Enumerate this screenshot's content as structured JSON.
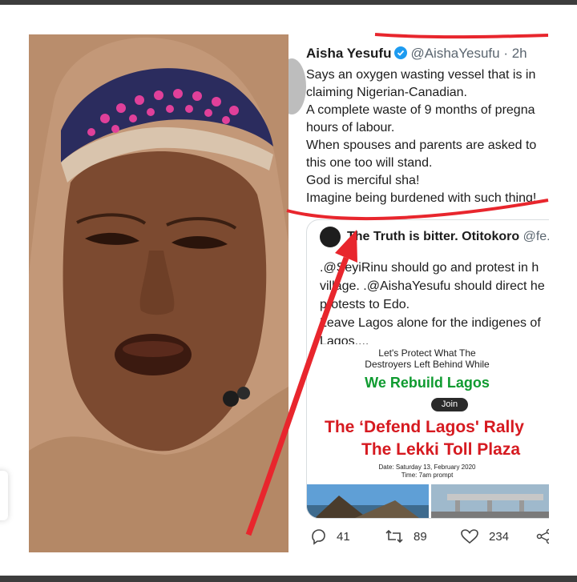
{
  "tweet": {
    "display_name": "Aisha Yesufu",
    "handle_time": "@AishaYesufu · 2h",
    "lines": [
      "Says an oxygen wasting vessel that is in",
      "claiming Nigerian-Canadian.",
      "A complete waste of 9 months of pregna",
      "hours of labour.",
      "When spouses and parents are asked to",
      "this one too will stand.",
      "God is merciful sha!",
      "Imagine being burdened with such thing!"
    ]
  },
  "quoted": {
    "display_name": "The Truth is bitter. Otitokoro",
    "handle": "@fe..",
    "lines": [
      ".@SeyiRinu should go and protest in h",
      "village. .@AishaYesufu should direct he",
      "protests to Edo.",
      "Leave Lagos alone for the indigenes of",
      "Lagos...."
    ],
    "flyer": {
      "line1": "Let's Protect What The",
      "line2": "Destroyers Left Behind While",
      "rebuild": "We Rebuild Lagos",
      "join": "Join",
      "title1": "The ‘Defend Lagos' Rally",
      "title2": "The Lekki Toll Plaza",
      "date": "Date: Saturday 13, February 2020",
      "time": "Time: 7am prompt"
    }
  },
  "actions": {
    "reply_count": "41",
    "retweet_count": "89",
    "like_count": "234"
  },
  "colors": {
    "verified": "#1d9bf0",
    "annotation_red": "#e8262d",
    "flyer_green": "#0f9b30",
    "flyer_red": "#d61a20"
  }
}
